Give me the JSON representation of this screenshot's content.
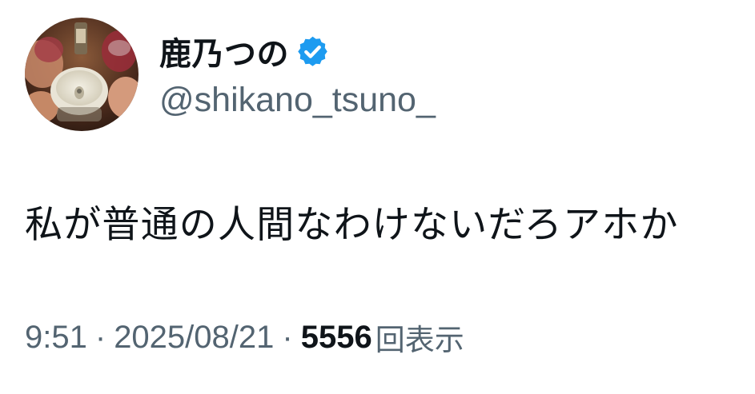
{
  "author": {
    "display_name": "鹿乃つの",
    "handle": "@shikano_tsuno_",
    "verified": true,
    "verified_color": "#1d9bf0"
  },
  "tweet": {
    "text": "私が普通の人間なわけないだろアホか"
  },
  "meta": {
    "time": "9:51",
    "separator": "·",
    "date": "2025/08/21",
    "views_count": "5556",
    "views_label": "回表示"
  },
  "colors": {
    "text_primary": "#0f1419",
    "text_secondary": "#536471",
    "background": "#ffffff"
  },
  "icons": {
    "avatar": "profile-photo",
    "verified": "verified-badge-icon"
  }
}
